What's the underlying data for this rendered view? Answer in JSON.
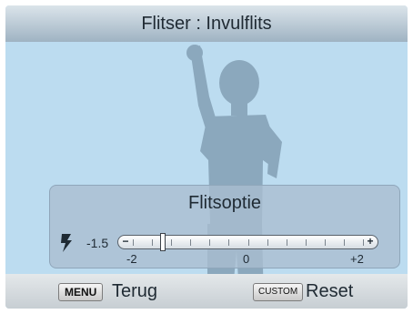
{
  "header": {
    "title": "Flitser : Invulflits"
  },
  "panel": {
    "title": "Flitsoptie",
    "current_value": "-1.5",
    "min_label": "-2",
    "mid_label": "0",
    "max_label": "+2",
    "minus_symbol": "−",
    "plus_symbol": "+",
    "slider_value": -1.5,
    "slider_min": -2,
    "slider_max": 2
  },
  "footer": {
    "menu_key": "MENU",
    "menu_label": "Terug",
    "custom_key": "CUSTOM",
    "custom_label": "Reset"
  },
  "icons": {
    "flash": "flash-icon"
  },
  "colors": {
    "background": "#bcdcf0",
    "silhouette": "#8ba8bd"
  }
}
